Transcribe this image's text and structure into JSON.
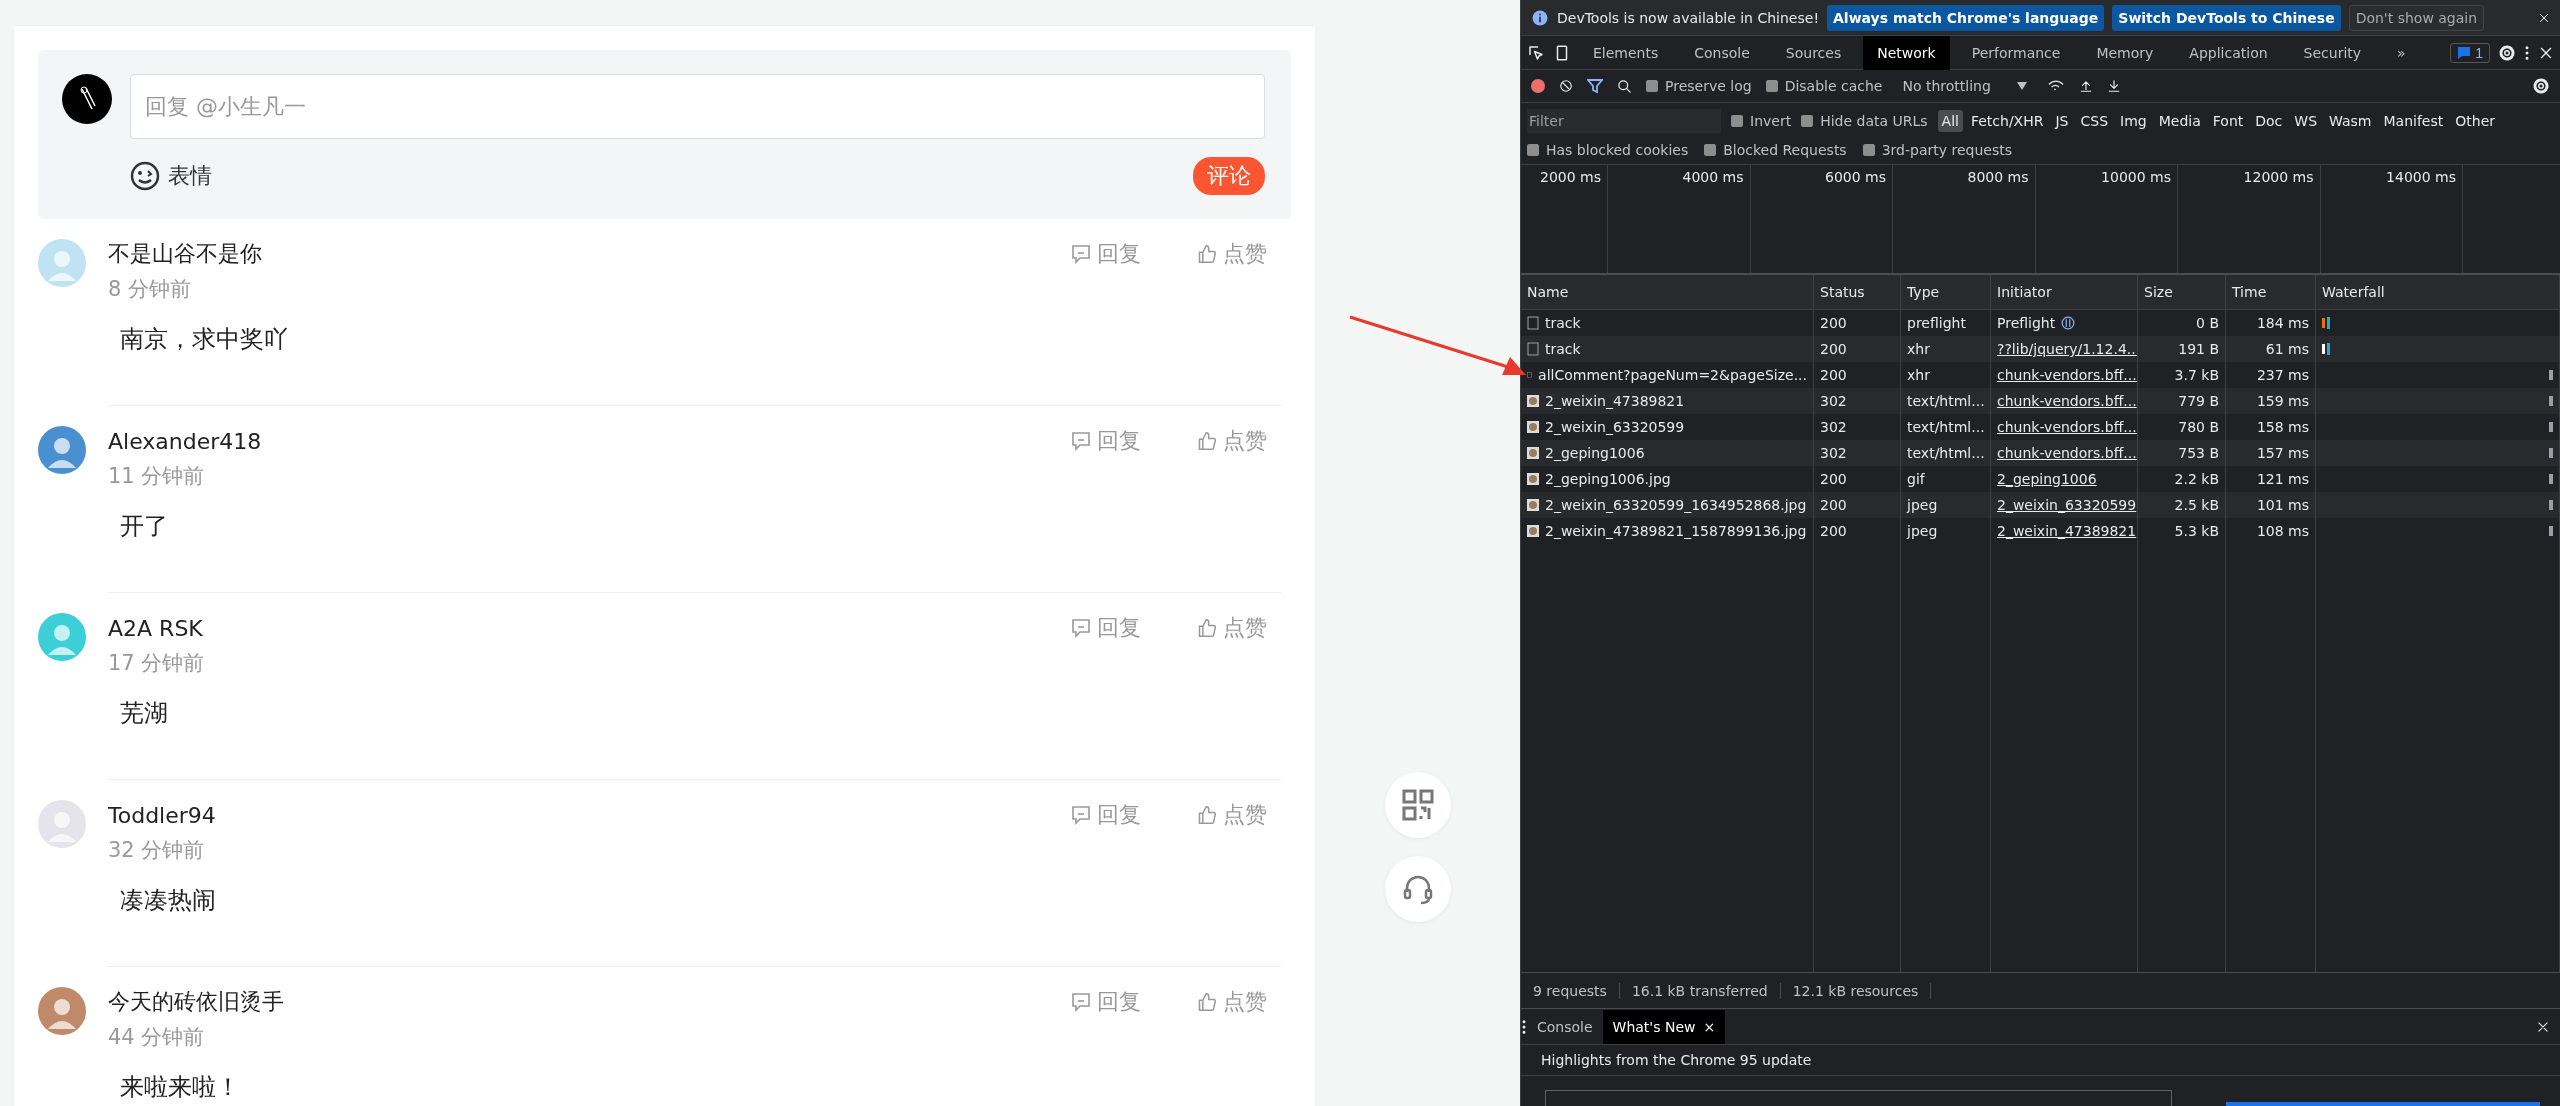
{
  "reply_box": {
    "placeholder": "回复 @小生凡一",
    "emoji_label": "表情",
    "submit": "评论"
  },
  "comments": [
    {
      "user": "不是山谷不是你",
      "time": "8 分钟前",
      "text": "南京，求中奖吖",
      "reply": "回复",
      "like": "点赞"
    },
    {
      "user": "Alexander418",
      "time": "11 分钟前",
      "text": "开了",
      "reply": "回复",
      "like": "点赞"
    },
    {
      "user": "A2A RSK",
      "time": "17 分钟前",
      "text": "芜湖",
      "reply": "回复",
      "like": "点赞"
    },
    {
      "user": "Toddler94",
      "time": "32 分钟前",
      "text": "凑凑热闹",
      "reply": "回复",
      "like": "点赞"
    },
    {
      "user": "今天的砖依旧烫手",
      "time": "44 分钟前",
      "text": "来啦来啦！",
      "reply": "回复",
      "like": "点赞"
    }
  ],
  "devtools": {
    "infobar": {
      "message": "DevTools is now available in Chinese!",
      "buttons": [
        "Always match Chrome's language",
        "Switch DevTools to Chinese"
      ],
      "dismiss": "Don't show again"
    },
    "tabs": [
      {
        "label": "Elements",
        "selected": false
      },
      {
        "label": "Console",
        "selected": false
      },
      {
        "label": "Sources",
        "selected": false
      },
      {
        "label": "Network",
        "selected": true
      },
      {
        "label": "Performance",
        "selected": false
      },
      {
        "label": "Memory",
        "selected": false
      },
      {
        "label": "Application",
        "selected": false
      },
      {
        "label": "Security",
        "selected": false
      }
    ],
    "more_tabs": "»",
    "issues_count": "1",
    "toolbar": {
      "preserve_log": {
        "label": "Preserve log",
        "checked": false
      },
      "disable_cache": {
        "label": "Disable cache",
        "checked": false
      },
      "throttling": "No throttling"
    },
    "filter": {
      "placeholder": "Filter",
      "invert": {
        "label": "Invert",
        "checked": false
      },
      "hide_data_urls": {
        "label": "Hide data URLs",
        "checked": false
      },
      "types": [
        {
          "label": "All",
          "selected": true
        },
        {
          "label": "Fetch/XHR",
          "selected": false
        },
        {
          "label": "JS",
          "selected": false
        },
        {
          "label": "CSS",
          "selected": false
        },
        {
          "label": "Img",
          "selected": false
        },
        {
          "label": "Media",
          "selected": false
        },
        {
          "label": "Font",
          "selected": false
        },
        {
          "label": "Doc",
          "selected": false
        },
        {
          "label": "WS",
          "selected": false
        },
        {
          "label": "Wasm",
          "selected": false
        },
        {
          "label": "Manifest",
          "selected": false
        },
        {
          "label": "Other",
          "selected": false
        }
      ],
      "extra": [
        {
          "label": "Has blocked cookies",
          "checked": false
        },
        {
          "label": "Blocked Requests",
          "checked": false
        },
        {
          "label": "3rd-party requests",
          "checked": false
        }
      ]
    },
    "overview_ticks": [
      "2000 ms",
      "4000 ms",
      "6000 ms",
      "8000 ms",
      "10000 ms",
      "12000 ms",
      "14000 ms"
    ],
    "table": {
      "columns": [
        "Name",
        "Status",
        "Type",
        "Initiator",
        "Size",
        "Time",
        "Waterfall"
      ],
      "rows": [
        {
          "kind": "document",
          "name": "track",
          "status": "200",
          "type": "preflight",
          "initiator": "Preflight",
          "initiator_link": false,
          "size": "0 B",
          "time": "184 ms"
        },
        {
          "kind": "document",
          "name": "track",
          "status": "200",
          "type": "xhr",
          "initiator": "??lib/jquery/1.12.4...",
          "initiator_link": true,
          "size": "191 B",
          "time": "61 ms"
        },
        {
          "kind": "document",
          "name": "allComment?pageNum=2&pageSize...",
          "status": "200",
          "type": "xhr",
          "initiator": "chunk-vendors.bff...",
          "initiator_link": true,
          "size": "3.7 kB",
          "time": "237 ms"
        },
        {
          "kind": "image",
          "name": "2_weixin_47389821",
          "status": "302",
          "type": "text/html...",
          "initiator": "chunk-vendors.bff...",
          "initiator_link": true,
          "size": "779 B",
          "time": "159 ms"
        },
        {
          "kind": "image",
          "name": "2_weixin_63320599",
          "status": "302",
          "type": "text/html...",
          "initiator": "chunk-vendors.bff...",
          "initiator_link": true,
          "size": "780 B",
          "time": "158 ms"
        },
        {
          "kind": "image",
          "name": "2_geping1006",
          "status": "302",
          "type": "text/html...",
          "initiator": "chunk-vendors.bff...",
          "initiator_link": true,
          "size": "753 B",
          "time": "157 ms"
        },
        {
          "kind": "image",
          "name": "2_geping1006.jpg",
          "status": "200",
          "type": "gif",
          "initiator": "2_geping1006",
          "initiator_link": true,
          "size": "2.2 kB",
          "time": "121 ms"
        },
        {
          "kind": "image",
          "name": "2_weixin_63320599_1634952868.jpg",
          "status": "200",
          "type": "jpeg",
          "initiator": "2_weixin_63320599",
          "initiator_link": true,
          "size": "2.5 kB",
          "time": "101 ms"
        },
        {
          "kind": "image",
          "name": "2_weixin_47389821_1587899136.jpg",
          "status": "200",
          "type": "jpeg",
          "initiator": "2_weixin_47389821",
          "initiator_link": true,
          "size": "5.3 kB",
          "time": "108 ms"
        }
      ]
    },
    "status_bar": [
      "9 requests",
      "16.1 kB transferred",
      "12.1 kB resources"
    ],
    "drawer": {
      "tabs": [
        {
          "label": "Console",
          "selected": false
        },
        {
          "label": "What's New",
          "selected": true
        }
      ],
      "close_tab": "×",
      "headline": "Highlights from the Chrome 95 update"
    }
  }
}
